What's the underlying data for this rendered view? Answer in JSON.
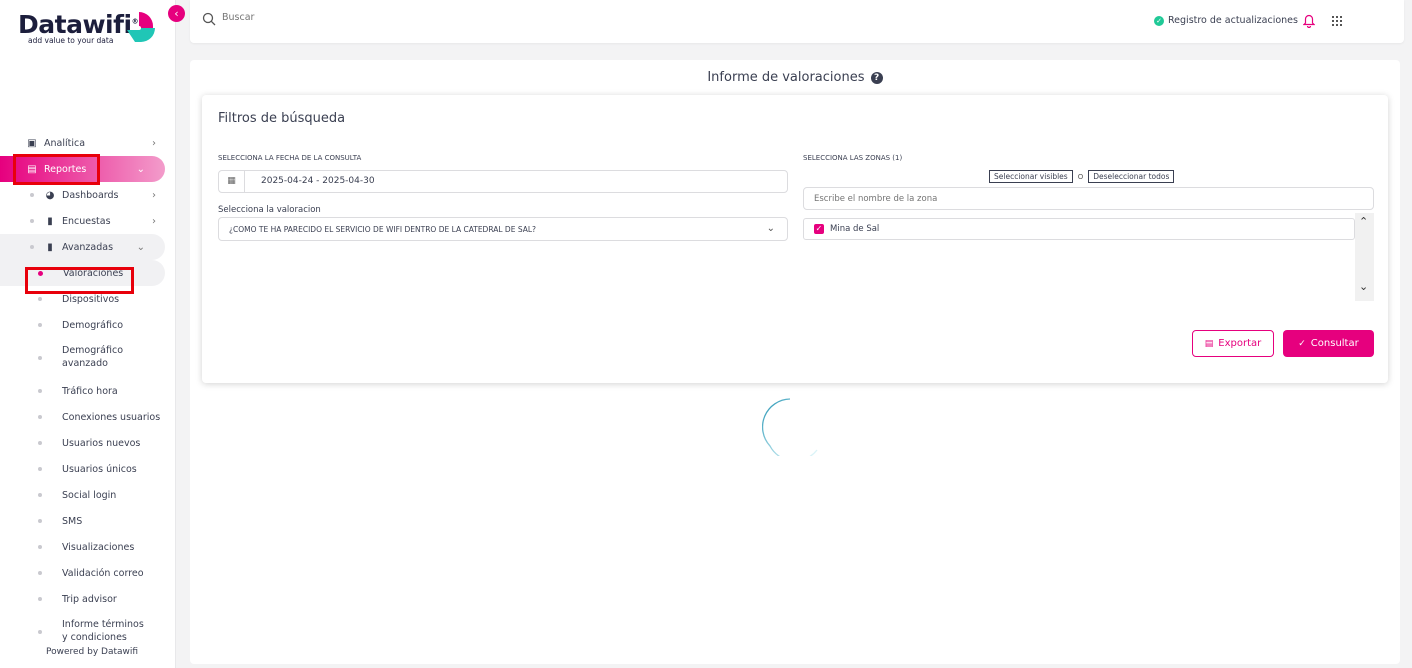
{
  "brand": {
    "name": "Datawifi",
    "tagline": "add value to your data",
    "accent": "#e6007e",
    "secondary": "#20c6b6"
  },
  "sidebar": {
    "items": [
      {
        "label": "Analítica",
        "icon": "chart-icon"
      },
      {
        "label": "Reportes",
        "icon": "file-icon"
      },
      {
        "label": "Dashboards",
        "icon": "gauge-icon"
      },
      {
        "label": "Encuestas",
        "icon": "clipboard-icon"
      },
      {
        "label": "Avanzadas",
        "icon": "bar-chart-icon"
      }
    ],
    "subitems": [
      "Valoraciones",
      "Dispositivos",
      "Demográfico",
      "Demográfico avanzado",
      "Tráfico hora",
      "Conexiones usuarios",
      "Usuarios nuevos",
      "Usuarios únicos",
      "Social login",
      "SMS",
      "Visualizaciones",
      "Validación correo",
      "Trip advisor",
      "Informe términos y condiciones"
    ],
    "footer": "Powered by Datawifi"
  },
  "topbar": {
    "search_placeholder": "Buscar",
    "updates_label": "Registro de actualizaciones"
  },
  "page": {
    "title": "Informe de valoraciones",
    "filters_title": "Filtros de búsqueda",
    "date_label": "SELECCIONA LA FECHA DE LA CONSULTA",
    "date_value": "2025-04-24 - 2025-04-30",
    "rating_label": "Selecciona la valoracion",
    "rating_value": "¿COMO TE HA PARECIDO EL SERVICIO DE WIFI DENTRO DE LA CATEDRAL DE SAL?",
    "zones_label": "SELECCIONA LAS ZONAS (1)",
    "select_visible": "Seleccionar visibles",
    "separator": "O",
    "deselect_all": "Deseleccionar todos",
    "zone_search_placeholder": "Escribe el nombre de la zona",
    "zones": [
      {
        "name": "Mina de Sal",
        "checked": true
      }
    ],
    "export_label": "Exportar",
    "consult_label": "Consultar"
  }
}
